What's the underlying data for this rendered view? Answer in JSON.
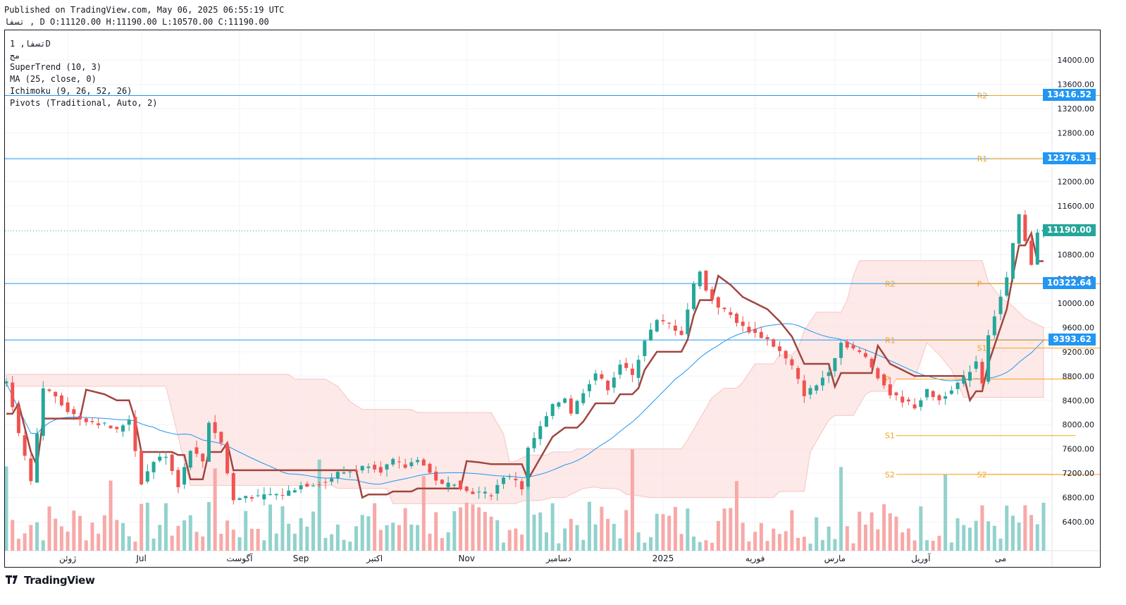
{
  "header": {
    "published": "Published on TradingView.com, May 06, 2025 06:55:19 UTC",
    "ohlc": "تسفا , D O:11120.00 H:11190.00 L:10570.00 C:11190.00"
  },
  "legend": {
    "symbol": "تسفا, 1D",
    "market": "مج",
    "indicators": [
      "SuperTrend (10, 3)",
      "MA (25, close, 0)",
      "Ichimoku (9, 26, 52, 26)",
      "Pivots (Traditional, Auto, 2)"
    ]
  },
  "price_tags": [
    {
      "label": "13416.52",
      "value": 13416.52,
      "color": "#2196f3"
    },
    {
      "label": "12376.31",
      "value": 12376.31,
      "color": "#2196f3"
    },
    {
      "label": "11190.00",
      "value": 11190.0,
      "color": "#26a69a"
    },
    {
      "label": "10322.64",
      "value": 10322.64,
      "color": "#2196f3"
    },
    {
      "label": "9393.62",
      "value": 9393.62,
      "color": "#2196f3"
    }
  ],
  "brand": "TradingView",
  "colors": {
    "up": "#26a69a",
    "down": "#ef5350",
    "vol_up": "#92d2cc",
    "vol_down": "#f7a9a7",
    "supertrend_up": "#43a047",
    "supertrend_down": "#a1453f",
    "ma": "#2196f3",
    "cloud_red": "#fce4e3",
    "cloud_green": "#e6f3e6",
    "pivot": "#f7a21b",
    "hline": "#2196f3"
  },
  "chart_data": {
    "type": "candlestick",
    "y_axis": {
      "ticks": [
        14000,
        13600,
        13200,
        12800,
        12400,
        12000,
        11600,
        10800,
        10400,
        10000,
        9600,
        9200,
        8800,
        8400,
        8000,
        7600,
        7200,
        6800,
        6400
      ],
      "tick_labels": [
        "14000.00",
        "13600.00",
        "13200.00",
        "12800.00",
        "12400.00",
        "12000.00",
        "11600.00",
        "10800.00",
        "10400.00",
        "10000.00",
        "9600.00",
        "9200.00",
        "8800.00",
        "8400.00",
        "8000.00",
        "7600.00",
        "7200.00",
        "6800.00",
        "6400.00"
      ],
      "range": [
        5960,
        14490
      ]
    },
    "x_axis": {
      "labels": [
        "ژوئن",
        "Jul",
        "آگوست",
        "Sep",
        "اکتبر",
        "Nov",
        "دسامبر",
        "2025",
        "فوریه",
        "مارس",
        "آوریل",
        "می"
      ],
      "label_index": [
        10,
        22,
        38,
        48,
        60,
        75,
        90,
        107,
        122,
        135,
        149,
        162
      ]
    },
    "horizontal_lines": [
      13416.52,
      12376.31,
      10322.64,
      9393.62
    ],
    "last_price": 11190.0,
    "pivots": [
      {
        "from": 145,
        "to": 165,
        "levels": [
          {
            "label": "R2",
            "value": 10320
          },
          {
            "label": "R1",
            "value": 9390
          },
          {
            "label": "P",
            "value": 8750
          },
          {
            "label": "S1",
            "value": 7820
          },
          {
            "label": "S2",
            "value": 7180
          }
        ]
      },
      {
        "from": 160,
        "to": 170,
        "levels": [
          {
            "label": "R2",
            "value": 13416
          },
          {
            "label": "R1",
            "value": 12376
          },
          {
            "label": "P",
            "value": 10320
          },
          {
            "label": "S1",
            "value": 9260
          },
          {
            "label": "S2",
            "value": 7180
          }
        ]
      }
    ],
    "anchors": [
      [
        0,
        8680
      ],
      [
        2,
        7850
      ],
      [
        4,
        7050
      ],
      [
        6,
        8600
      ],
      [
        8,
        8480
      ],
      [
        10,
        8230
      ],
      [
        12,
        8100
      ],
      [
        14,
        8050
      ],
      [
        16,
        8000
      ],
      [
        18,
        7900
      ],
      [
        20,
        8100
      ],
      [
        22,
        7050
      ],
      [
        24,
        7400
      ],
      [
        26,
        7500
      ],
      [
        28,
        7000
      ],
      [
        30,
        7600
      ],
      [
        32,
        7400
      ],
      [
        33,
        8050
      ],
      [
        35,
        7700
      ],
      [
        36,
        7200
      ],
      [
        37,
        6750
      ],
      [
        39,
        6830
      ],
      [
        41,
        6800
      ],
      [
        43,
        6850
      ],
      [
        45,
        6850
      ],
      [
        48,
        7000
      ],
      [
        52,
        7050
      ],
      [
        54,
        7200
      ],
      [
        57,
        7250
      ],
      [
        59,
        7350
      ],
      [
        61,
        7250
      ],
      [
        63,
        7400
      ],
      [
        65,
        7300
      ],
      [
        67,
        7450
      ],
      [
        69,
        7200
      ],
      [
        71,
        7000
      ],
      [
        73,
        7050
      ],
      [
        75,
        6900
      ],
      [
        77,
        6880
      ],
      [
        79,
        6850
      ],
      [
        81,
        7150
      ],
      [
        83,
        7100
      ],
      [
        84,
        6950
      ],
      [
        85,
        7600
      ],
      [
        87,
        7950
      ],
      [
        89,
        8300
      ],
      [
        91,
        8450
      ],
      [
        92,
        8200
      ],
      [
        94,
        8550
      ],
      [
        96,
        8850
      ],
      [
        98,
        8600
      ],
      [
        100,
        9000
      ],
      [
        102,
        8800
      ],
      [
        104,
        9400
      ],
      [
        106,
        9700
      ],
      [
        108,
        9650
      ],
      [
        110,
        9500
      ],
      [
        111,
        9900
      ],
      [
        112,
        10300
      ],
      [
        113,
        10550
      ],
      [
        114,
        10200
      ],
      [
        116,
        9950
      ],
      [
        118,
        9800
      ],
      [
        120,
        9600
      ],
      [
        122,
        9500
      ],
      [
        124,
        9400
      ],
      [
        126,
        9200
      ],
      [
        128,
        8950
      ],
      [
        130,
        8500
      ],
      [
        132,
        8650
      ],
      [
        134,
        8900
      ],
      [
        136,
        9350
      ],
      [
        138,
        9250
      ],
      [
        140,
        9100
      ],
      [
        142,
        8800
      ],
      [
        144,
        8500
      ],
      [
        146,
        8400
      ],
      [
        148,
        8300
      ],
      [
        150,
        8550
      ],
      [
        152,
        8400
      ],
      [
        154,
        8600
      ],
      [
        156,
        8750
      ],
      [
        158,
        9050
      ],
      [
        159,
        8700
      ],
      [
        160,
        9500
      ],
      [
        162,
        10100
      ],
      [
        163,
        10400
      ],
      [
        164,
        10950
      ],
      [
        165,
        11450
      ],
      [
        166,
        11000
      ],
      [
        167,
        10650
      ],
      [
        168,
        11190
      ]
    ],
    "ohlc_last": {
      "open": 11120,
      "high": 11190,
      "low": 10570,
      "close": 11190
    }
  }
}
